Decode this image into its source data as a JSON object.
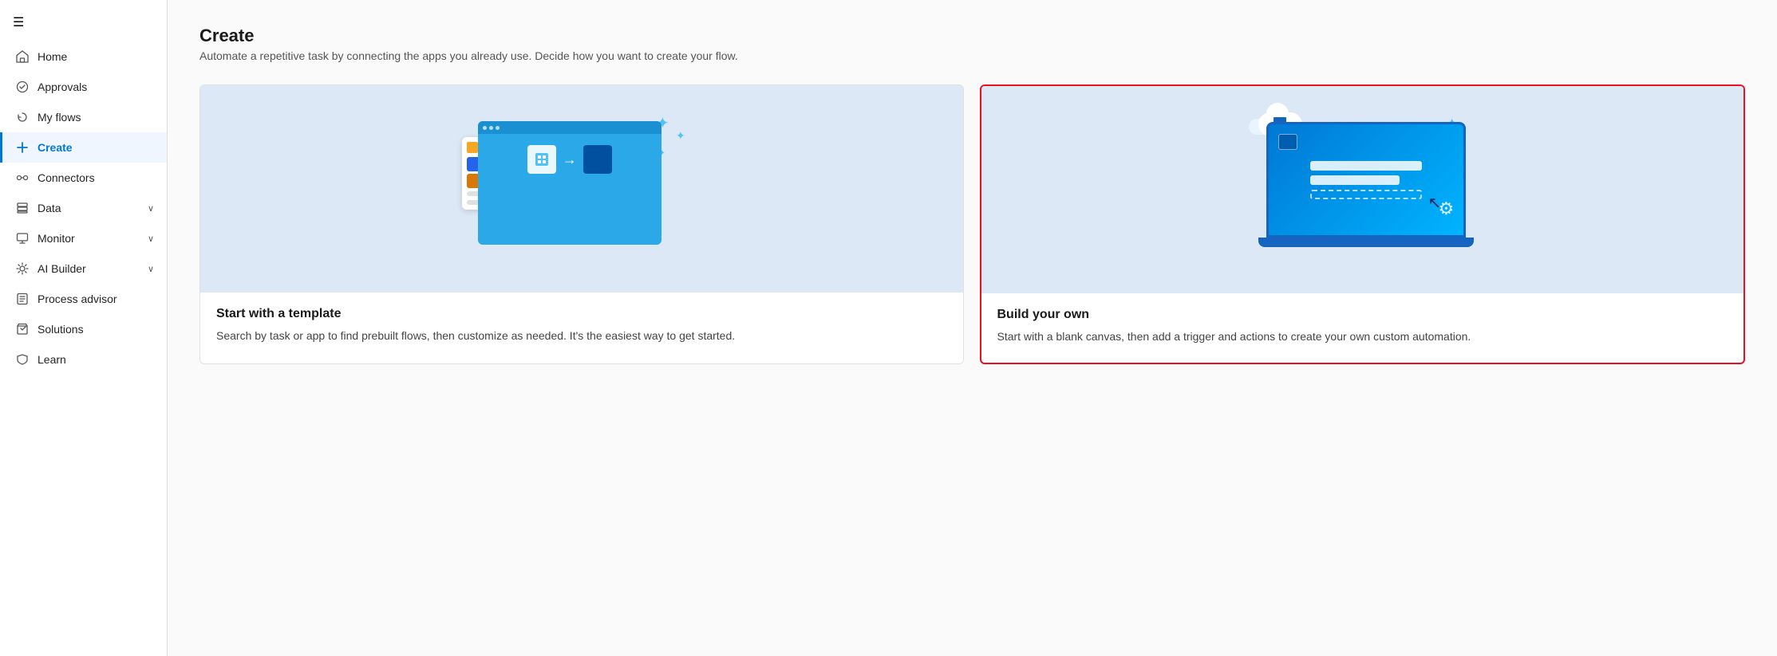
{
  "sidebar": {
    "hamburger_icon": "☰",
    "items": [
      {
        "id": "home",
        "label": "Home",
        "icon": "🏠",
        "expandable": false,
        "active": false
      },
      {
        "id": "approvals",
        "label": "Approvals",
        "icon": "✓",
        "expandable": false,
        "active": false
      },
      {
        "id": "my-flows",
        "label": "My flows",
        "icon": "⟳",
        "expandable": false,
        "active": false
      },
      {
        "id": "create",
        "label": "Create",
        "icon": "+",
        "expandable": false,
        "active": true
      },
      {
        "id": "connectors",
        "label": "Connectors",
        "icon": "⚡",
        "expandable": false,
        "active": false
      },
      {
        "id": "data",
        "label": "Data",
        "icon": "⊞",
        "expandable": true,
        "active": false
      },
      {
        "id": "monitor",
        "label": "Monitor",
        "icon": "📊",
        "expandable": true,
        "active": false
      },
      {
        "id": "ai-builder",
        "label": "AI Builder",
        "icon": "🤖",
        "expandable": true,
        "active": false
      },
      {
        "id": "process-advisor",
        "label": "Process advisor",
        "icon": "📋",
        "expandable": false,
        "active": false
      },
      {
        "id": "solutions",
        "label": "Solutions",
        "icon": "📦",
        "expandable": false,
        "active": false
      },
      {
        "id": "learn",
        "label": "Learn",
        "icon": "📖",
        "expandable": false,
        "active": false
      }
    ]
  },
  "main": {
    "title": "Create",
    "subtitle": "Automate a repetitive task by connecting the apps you already use. Decide how you want to create your flow.",
    "cards": [
      {
        "id": "template",
        "title": "Start with a template",
        "description": "Search by task or app to find prebuilt flows, then customize as needed. It's the easiest way to get started.",
        "selected": false
      },
      {
        "id": "build-own",
        "title": "Build your own",
        "description": "Start with a blank canvas, then add a trigger and actions to create your own custom automation.",
        "selected": true
      }
    ]
  }
}
